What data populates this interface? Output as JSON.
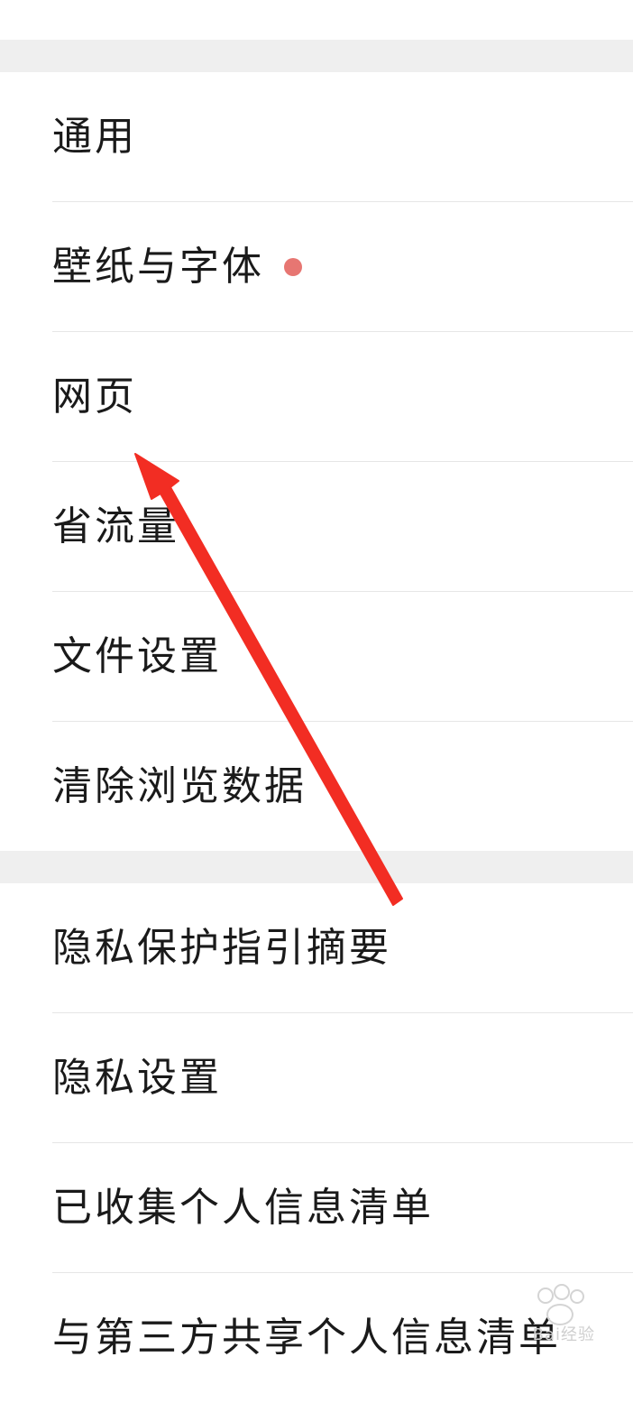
{
  "settings": {
    "group1": [
      {
        "label": "通用",
        "badge": false
      },
      {
        "label": "壁纸与字体",
        "badge": true,
        "badge_color": "#e77672"
      },
      {
        "label": "网页",
        "badge": false
      },
      {
        "label": "省流量",
        "badge": false
      },
      {
        "label": "文件设置",
        "badge": false
      },
      {
        "label": "清除浏览数据",
        "badge": false
      }
    ],
    "group2": [
      {
        "label": "隐私保护指引摘要"
      },
      {
        "label": "隐私设置"
      },
      {
        "label": "已收集个人信息清单"
      },
      {
        "label": "与第三方共享个人信息清单"
      }
    ]
  },
  "annotation": {
    "arrow_color": "#f22d23",
    "arrow_target": "网页"
  },
  "watermark": {
    "text": "Bai经验"
  },
  "colors": {
    "section_gap": "#efefef",
    "divider": "#e6e6e6",
    "text": "#1a1a1a"
  }
}
